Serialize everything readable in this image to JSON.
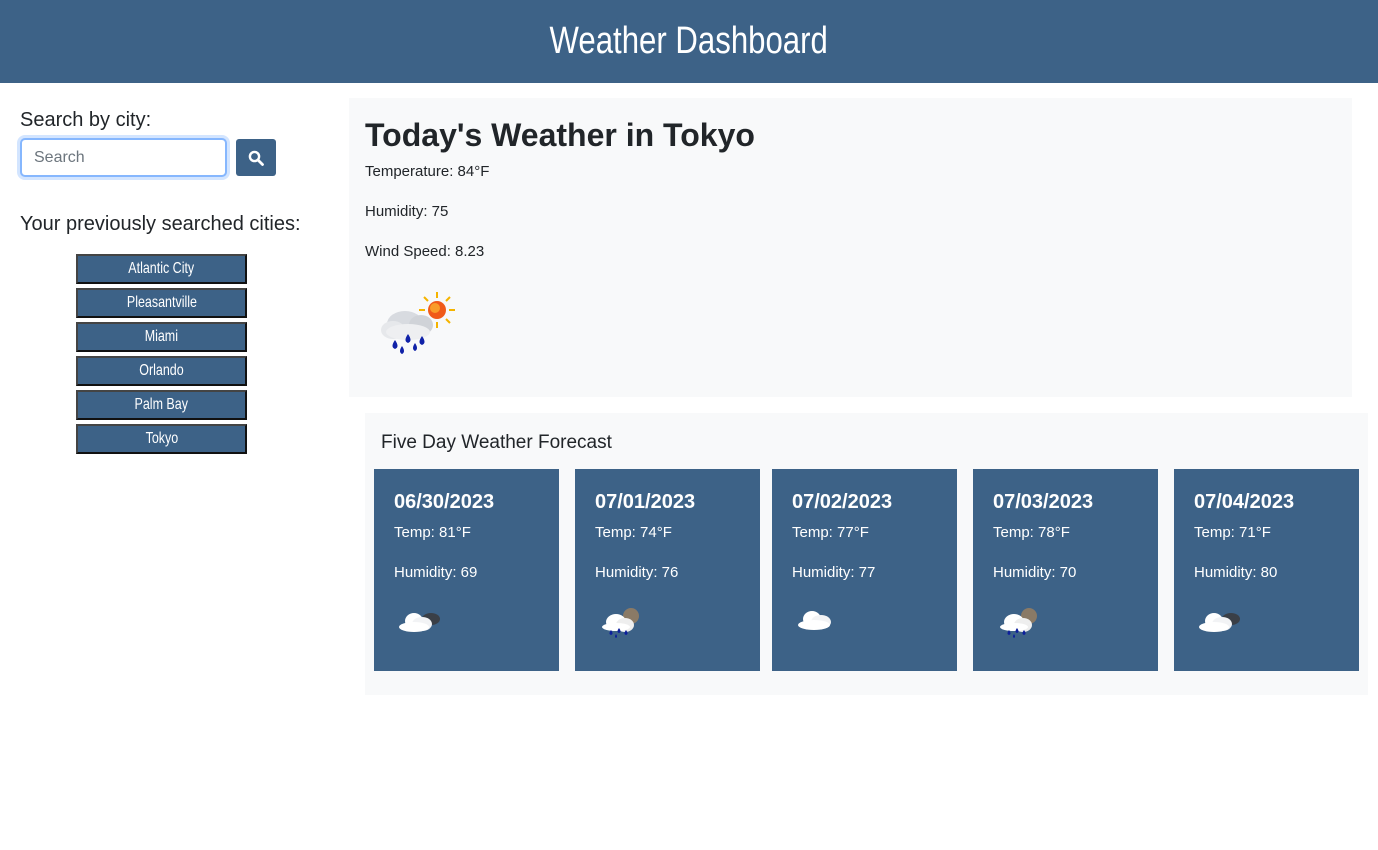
{
  "header": {
    "title": "Weather Dashboard"
  },
  "sidebar": {
    "search_label": "Search by city:",
    "search_placeholder": "Search",
    "search_value": "",
    "search_button_icon": "search-icon",
    "previous_label": "Your previously searched cities:",
    "cities": [
      "Atlantic City",
      "Pleasantville",
      "Miami",
      "Orlando",
      "Palm Bay",
      "Tokyo"
    ]
  },
  "today": {
    "title": "Today's Weather in Tokyo",
    "temperature": "Temperature: 84°F",
    "humidity": "Humidity: 75",
    "wind": "Wind Speed: 8.23",
    "icon": "rain-with-sun-icon"
  },
  "forecast": {
    "title": "Five Day Weather Forecast",
    "days": [
      {
        "date": "06/30/2023",
        "temp": "Temp: 81°F",
        "humidity": "Humidity: 69",
        "icon": "cloudy-night-icon"
      },
      {
        "date": "07/01/2023",
        "temp": "Temp: 74°F",
        "humidity": "Humidity: 76",
        "icon": "rain-night-icon"
      },
      {
        "date": "07/02/2023",
        "temp": "Temp: 77°F",
        "humidity": "Humidity: 77",
        "icon": "cloud-icon"
      },
      {
        "date": "07/03/2023",
        "temp": "Temp: 78°F",
        "humidity": "Humidity: 70",
        "icon": "rain-night-icon"
      },
      {
        "date": "07/04/2023",
        "temp": "Temp: 71°F",
        "humidity": "Humidity: 80",
        "icon": "cloudy-night-icon"
      }
    ]
  },
  "colors": {
    "primary": "#3d6287",
    "panel": "#f8f9fa",
    "text": "#212529"
  }
}
